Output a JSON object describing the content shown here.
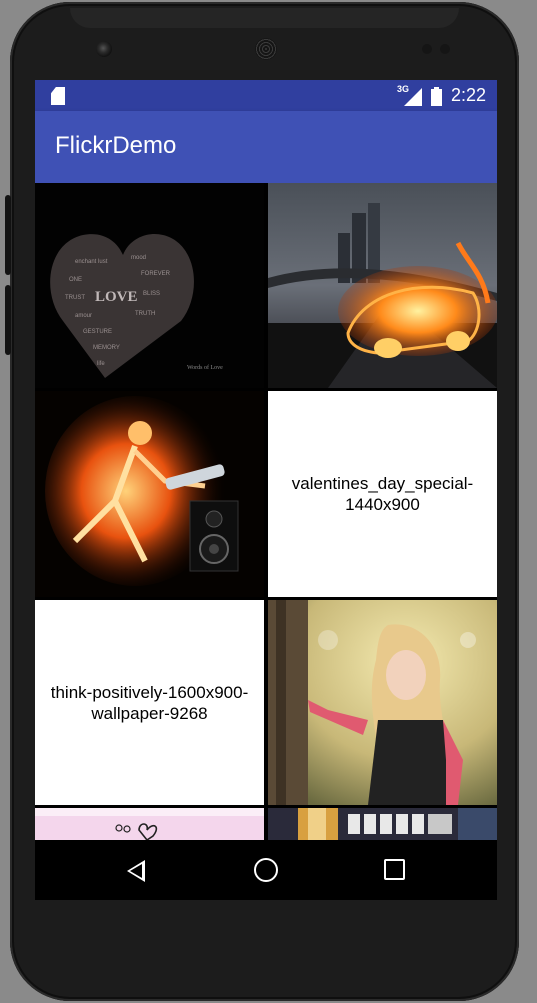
{
  "status_bar": {
    "network": "3G",
    "time": "2:22"
  },
  "app_bar": {
    "title": "FlickrDemo"
  },
  "photos": [
    {
      "type": "image",
      "subject": "Words of Love heart",
      "label": "LOVE",
      "credit": "Words of Love"
    },
    {
      "type": "image",
      "subject": "flaming car on bridge"
    },
    {
      "type": "image",
      "subject": "flaming skeleton guitarist"
    },
    {
      "type": "caption",
      "text": "valentines_day_special-1440x900"
    },
    {
      "type": "caption",
      "text": "think-positively-1600x900-wallpaper-9268"
    },
    {
      "type": "image",
      "subject": "girl leaning on tree"
    },
    {
      "type": "image",
      "subject": "pink hearts"
    },
    {
      "type": "image",
      "subject": "sunset window strip"
    }
  ],
  "nav_bar": {
    "back": "back-icon",
    "home": "home-icon",
    "recents": "recents-icon"
  },
  "colors": {
    "status_bar": "#303f9f",
    "app_bar": "#3f51b5",
    "screen_bg": "#000000",
    "caption_bg": "#ffffff"
  }
}
